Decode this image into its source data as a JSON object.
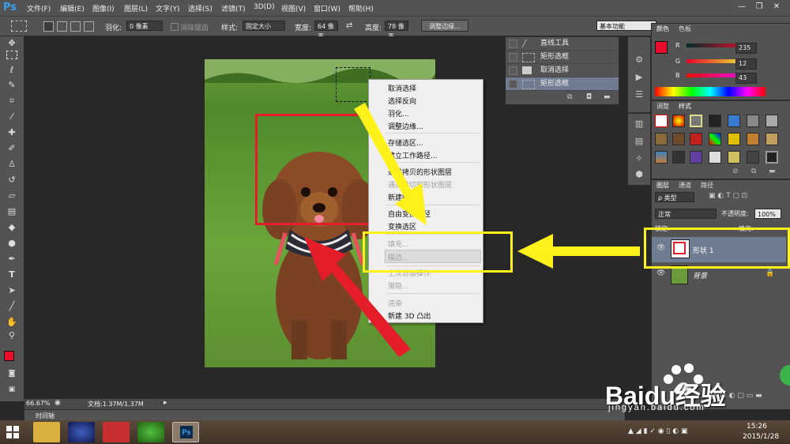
{
  "app": {
    "logo": "Ps"
  },
  "menu": [
    "文件(F)",
    "编辑(E)",
    "图像(I)",
    "图层(L)",
    "文字(Y)",
    "选择(S)",
    "滤镜(T)",
    "3D(D)",
    "视图(V)",
    "窗口(W)",
    "帮助(H)"
  ],
  "window_controls": {
    "minimize": "—",
    "restore": "❐",
    "close": "✕"
  },
  "options": {
    "feather_label": "羽化:",
    "feather_value": "0 像素",
    "antialias_label": "消除锯齿",
    "style_label": "样式:",
    "style_value": "固定大小",
    "width_label": "宽度:",
    "width_value": "64 像素",
    "height_label": "高度:",
    "height_value": "78 像素",
    "refine_edge": "调整边缘...",
    "workspace": "基本功能"
  },
  "history": {
    "items": [
      {
        "label": "直线工具",
        "icon": "line-icon"
      },
      {
        "label": "矩形选框",
        "icon": "marquee-icon"
      },
      {
        "label": "取消选择",
        "icon": "doc-icon"
      },
      {
        "label": "矩形选框",
        "icon": "marquee-icon",
        "active": true
      }
    ]
  },
  "context_menu": {
    "items": [
      {
        "label": "取消选择",
        "enabled": true
      },
      {
        "label": "选择反向",
        "enabled": true
      },
      {
        "label": "羽化...",
        "enabled": true
      },
      {
        "label": "调整边缘...",
        "enabled": true
      },
      {
        "label": "存储选区...",
        "enabled": true
      },
      {
        "label": "建立工作路径...",
        "enabled": true
      },
      {
        "label": "通过拷贝的形状图层",
        "enabled": true
      },
      {
        "label": "通过剪切的形状图层",
        "enabled": false
      },
      {
        "label": "新建图层...",
        "enabled": true
      },
      {
        "label": "自由变换路径",
        "enabled": true
      },
      {
        "label": "变换选区",
        "enabled": true
      },
      {
        "label": "填充...",
        "enabled": false
      },
      {
        "label": "描边...",
        "enabled": false
      },
      {
        "label": "上次滤镜操作",
        "enabled": false
      },
      {
        "label": "渐隐...",
        "enabled": false
      },
      {
        "label": "渲染",
        "enabled": false
      },
      {
        "label": "新建 3D 凸出",
        "enabled": true
      }
    ]
  },
  "status": {
    "zoom": "66.67%",
    "doc": "文档:1.37M/1.37M"
  },
  "timeline_label": "时间轴",
  "color_panel": {
    "tabs": [
      "颜色",
      "色板"
    ],
    "channels": [
      {
        "label": "R",
        "value": "235"
      },
      {
        "label": "G",
        "value": "12"
      },
      {
        "label": "B",
        "value": "43"
      }
    ],
    "foreground": "#eb0c2b",
    "background": "#ffffff"
  },
  "styles_panel": {
    "tabs": [
      "调整",
      "样式"
    ]
  },
  "layers_panel": {
    "tabs": [
      "图层",
      "通道",
      "路径"
    ],
    "filter_label": "ρ 类型",
    "blend_mode": "正常",
    "opacity_label": "不透明度:",
    "opacity_value": "100%",
    "lock_label": "锁定:",
    "fill_label": "填充:",
    "layers": [
      {
        "name": "形状 1",
        "selected": true
      },
      {
        "name": "背景",
        "selected": false
      }
    ]
  },
  "watermark": {
    "brand": "Baidu经验",
    "url": "jingyan.baidu.com"
  },
  "taskbar": {
    "time": "15:26",
    "date": "2015/1/28"
  },
  "colors": {
    "accent_yellow": "#fff21a",
    "accent_red": "#e51c2a",
    "selection_blue": "#6f7c91"
  }
}
